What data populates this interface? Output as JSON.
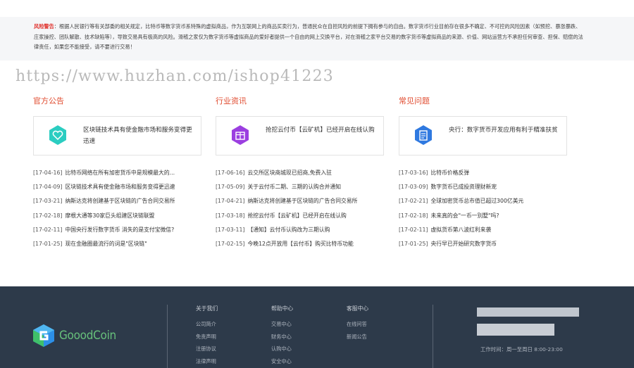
{
  "warning": {
    "label": "风险警告",
    "text": "：根据人民银行等有关部委的相关规定，比特币等数字货币系特殊的虚拟商品，作为互联网上的商品买卖行为，普通民众在自担风险的前提下拥有参与的自由。数字货币行业目前存在很多不确定、不可控的风险因素（如预挖、暴涨暴跌、庄家操控、团队解散、技术缺陷等），导致交易具有极高的风险。滑稽之家仅为数字货币等虚拟商品的爱好者提供一个自由的网上交换平台，对在滑稽之家平台交易的数字货币等虚拟商品的来源、价值、网站运营方不承担任何审查、担保、赔偿的法律责任，如果您不能接受，请不要进行交易！"
  },
  "watermark": "https://www.huzhan.com/ishop41223",
  "columns": [
    {
      "title": "官方公告",
      "card": {
        "icon": "heart-icon",
        "color": "#2bcdc1",
        "text": "区块链技术具有使金融市场和服务变得更迅速"
      },
      "news": [
        {
          "date": "[17-04-16]",
          "title": "比特币网络在所有加密货币中是规模最大的..."
        },
        {
          "date": "[17-04-09]",
          "title": "区块链技术具有使金融市场和服务变得更迅速"
        },
        {
          "date": "[17-03-21]",
          "title": "纳斯达克将创建基于区块链的广告合同交易所"
        },
        {
          "date": "[17-02-18]",
          "title": "摩根大通等30家巨头组建区块链联盟"
        },
        {
          "date": "[17-02-11]",
          "title": "中国央行发行数字货币 消失的是支付宝微信?"
        },
        {
          "date": "[17-01-25]",
          "title": "现在金融圈最流行的词是\"区块链\""
        }
      ]
    },
    {
      "title": "行业资讯",
      "card": {
        "icon": "gift-icon",
        "color": "#9b3fe0",
        "text": "抢挖云付币【云矿机】已经开启在线认购"
      },
      "news": [
        {
          "date": "[17-06-16]",
          "title": "云交所区块商城现已招商,免费入驻"
        },
        {
          "date": "[17-05-09]",
          "title": "关于云付币二期、三期的认购合并通知"
        },
        {
          "date": "[17-04-21]",
          "title": "纳斯达克将创建基于区块链的广告合同交易所"
        },
        {
          "date": "[17-03-18]",
          "title": "抢挖云付币【云矿机】已经开启在线认购"
        },
        {
          "date": "[17-03-11]",
          "title": "【通知】云付币认购改为三期认购"
        },
        {
          "date": "[17-02-15]",
          "title": "今晚12点开放用【云付币】购买比特币功能"
        }
      ]
    },
    {
      "title": "常见问题",
      "card": {
        "icon": "document-icon",
        "color": "#2f79e0",
        "text": "央行：数字货币开发应用有利于精准扶贫"
      },
      "news": [
        {
          "date": "[17-03-16]",
          "title": "比特币价格反弹"
        },
        {
          "date": "[17-03-09]",
          "title": "数字货币已成投资理财新宠"
        },
        {
          "date": "[17-02-21]",
          "title": "全球加密货币总市值已超过300亿美元"
        },
        {
          "date": "[17-02-18]",
          "title": "未来真的会\"一币一别墅\"吗?"
        },
        {
          "date": "[17-02-11]",
          "title": "虚拟货币第八波红利来袭"
        },
        {
          "date": "[17-01-25]",
          "title": "央行早已开始研究数字货币"
        }
      ]
    }
  ],
  "footer": {
    "logo_text": "GooodCoin",
    "links": [
      {
        "heading": "关于我们",
        "items": [
          "公司简介",
          "免责声明",
          "注册协议",
          "法律声明"
        ]
      },
      {
        "heading": "帮助中心",
        "items": [
          "交易中心",
          "财务中心",
          "认购中心",
          "安全中心"
        ]
      },
      {
        "heading": "客服中心",
        "items": [
          "在线问答",
          "新闻公告"
        ]
      }
    ],
    "hours": "工作时间：周一至周日 8:00-23:00"
  }
}
